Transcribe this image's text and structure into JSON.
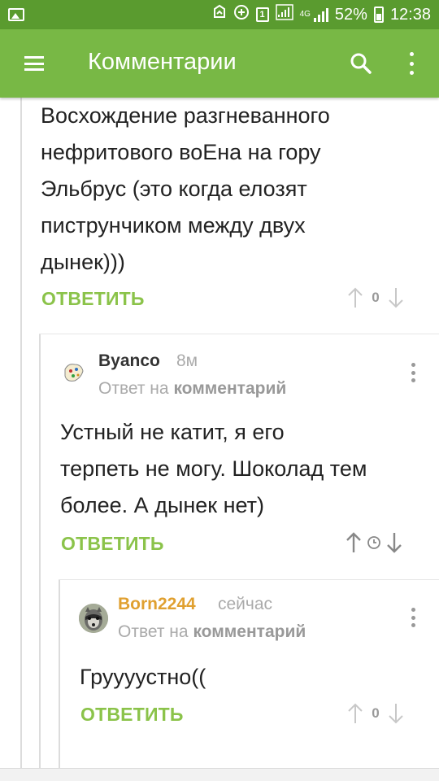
{
  "status_bar": {
    "network": "4G",
    "battery": "52%",
    "time": "12:38",
    "notification_badge": "1"
  },
  "app_bar": {
    "title": "Комментарии",
    "icons": [
      "menu-icon",
      "search-icon",
      "more-icon"
    ]
  },
  "comments": [
    {
      "text_lines": [
        "Восхождение разгневанного",
        "нефритового воЕна на гору",
        "Эльбрус (это когда елозят",
        "пиструнчиком между двух",
        "дынек)))"
      ],
      "reply_label": "ОТВЕТИТЬ",
      "rating": "0"
    },
    {
      "author": "Byanco",
      "time": "8м",
      "reply_to_prefix": "Ответ на",
      "reply_to_link": "комментарий",
      "text_lines": [
        "Устный не катит, я его",
        "терпеть не могу. Шоколад тем",
        "более. А дынек нет)"
      ],
      "reply_label": "ОТВЕТИТЬ",
      "rating_icon": "clock-icon"
    },
    {
      "author": "Born2244",
      "time": "сейчас",
      "reply_to_prefix": "Ответ на",
      "reply_to_link": "комментарий",
      "text_lines": [
        "Груууустно(("
      ],
      "reply_label": "ОТВЕТИТЬ",
      "rating": "0"
    }
  ],
  "colors": {
    "status_bar": "#5a9b2f",
    "app_bar": "#78b845",
    "reply_green": "#8bc34a",
    "author_byanco": "#333333",
    "author_born": "#e0a030"
  }
}
